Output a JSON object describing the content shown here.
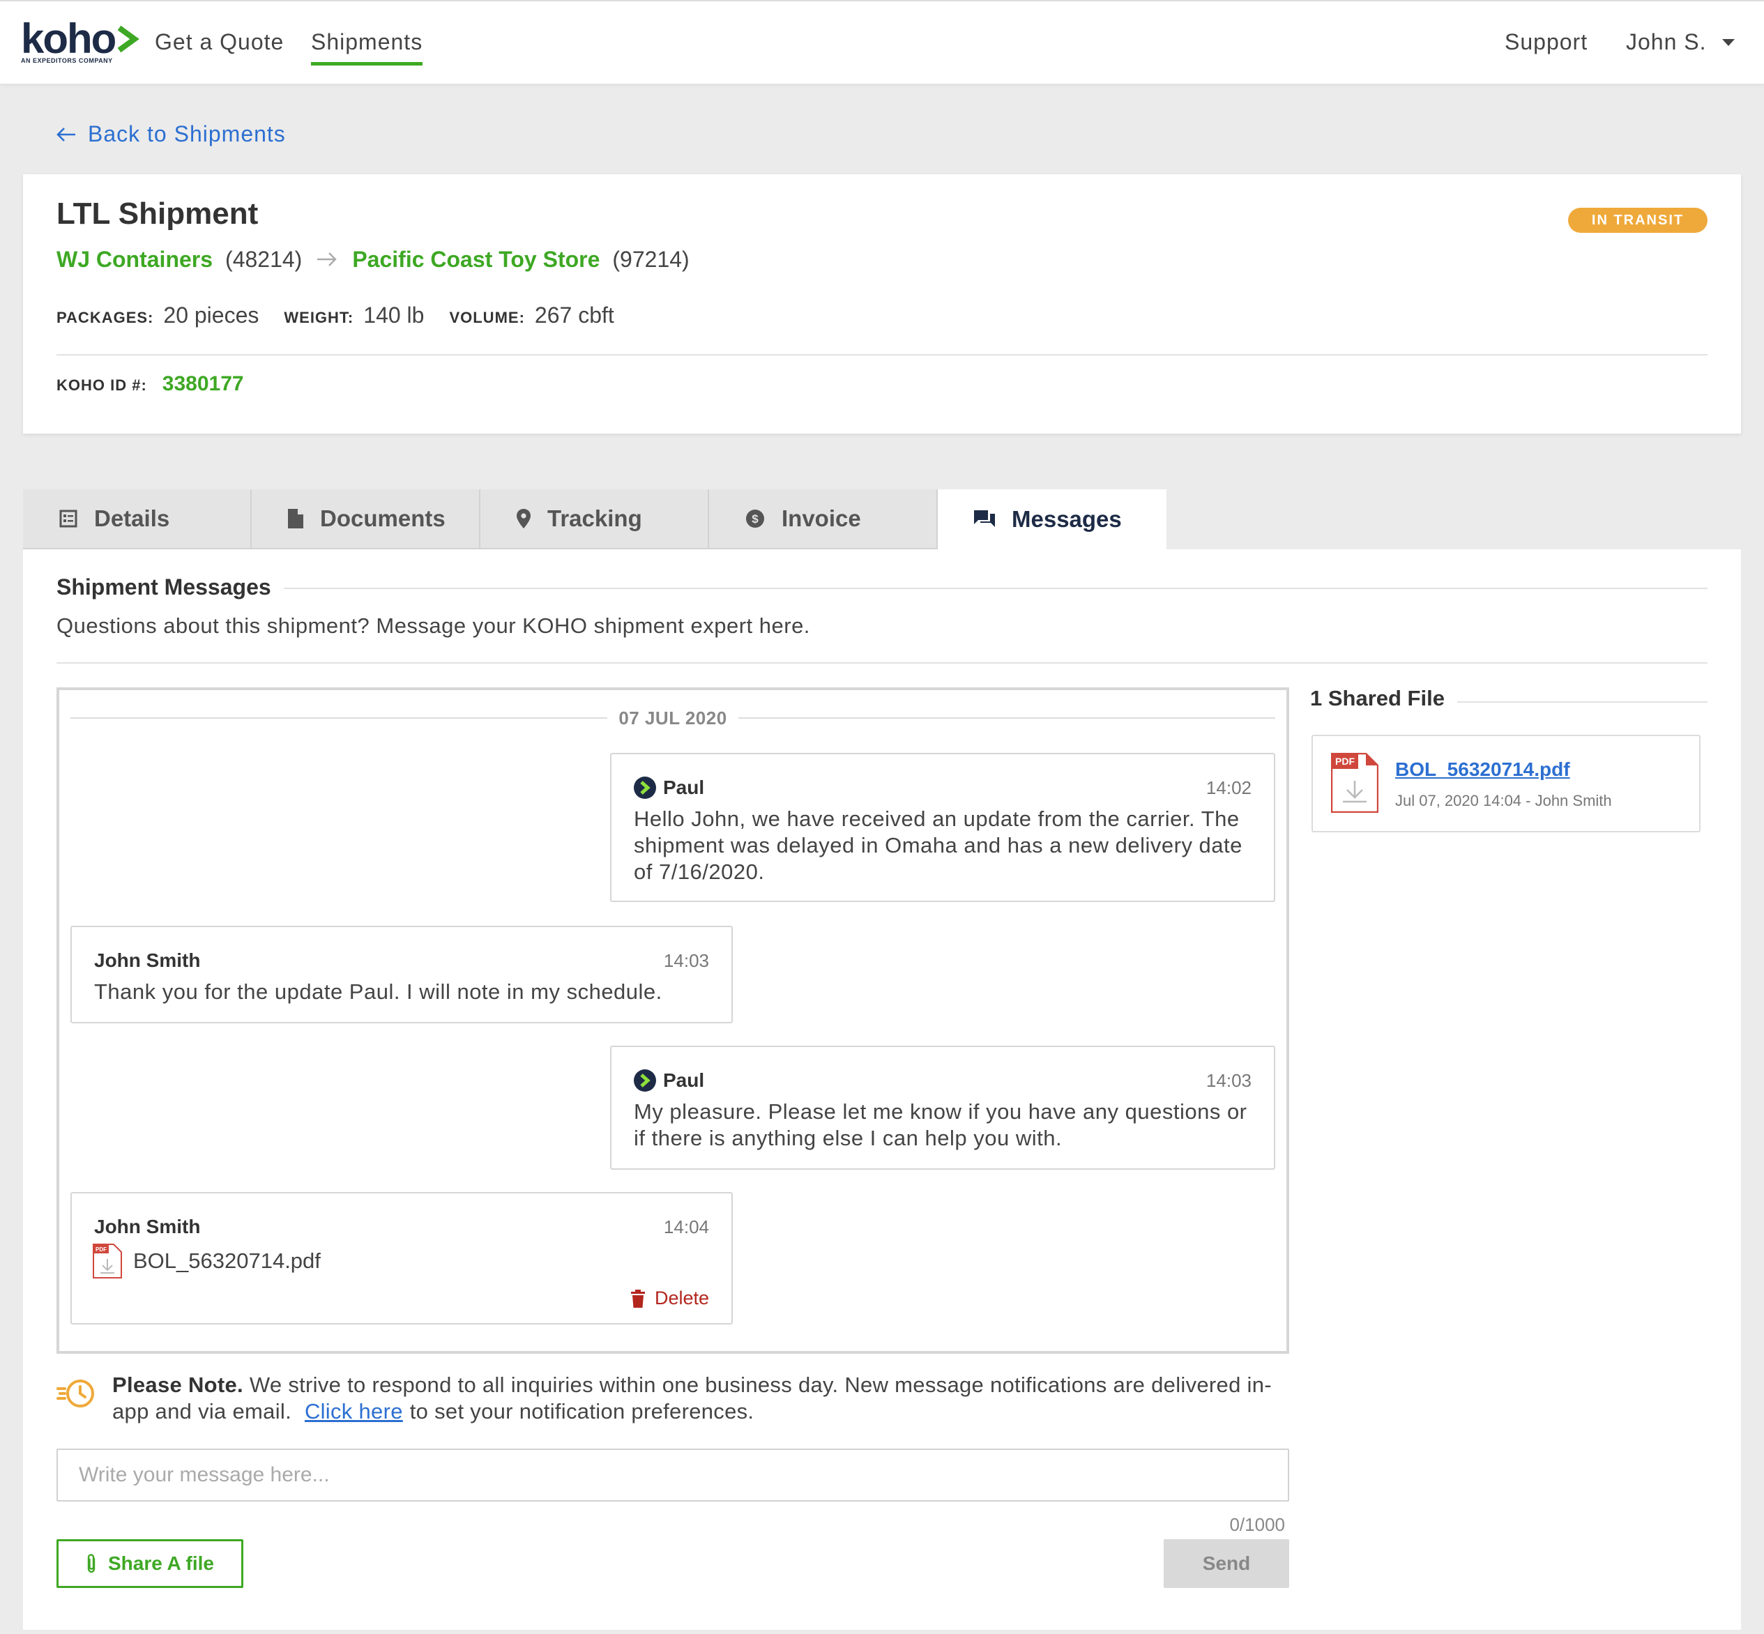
{
  "nav": {
    "logo_text": "koho",
    "logo_tagline": "AN EXPEDITORS COMPANY",
    "links": [
      "Get a Quote",
      "Shipments"
    ],
    "active_link": "Shipments",
    "support": "Support",
    "user": "John S."
  },
  "back_link": "Back to Shipments",
  "shipment": {
    "title": "LTL Shipment",
    "status": "IN TRANSIT",
    "origin": {
      "name": "WJ Containers",
      "zip": "(48214)"
    },
    "destination": {
      "name": "Pacific Coast Toy Store",
      "zip": "(97214)"
    },
    "packages_label": "PACKAGES:",
    "packages_value": "20 pieces",
    "weight_label": "WEIGHT:",
    "weight_value": "140 lb",
    "volume_label": "VOLUME:",
    "volume_value": "267 cbft",
    "koho_id_label": "KOHO ID #:",
    "koho_id_value": "3380177"
  },
  "tabs": [
    {
      "label": "Details",
      "icon": "details-icon"
    },
    {
      "label": "Documents",
      "icon": "document-icon"
    },
    {
      "label": "Tracking",
      "icon": "location-pin-icon"
    },
    {
      "label": "Invoice",
      "icon": "dollar-circle-icon"
    },
    {
      "label": "Messages",
      "icon": "chat-icon",
      "active": true
    }
  ],
  "messages_section": {
    "title": "Shipment Messages",
    "subtitle": "Questions about this shipment? Message your KOHO shipment expert here.",
    "date": "07 JUL 2020",
    "messages": [
      {
        "sender": "Paul",
        "time": "14:02",
        "text": "Hello John, we have received an update from the carrier. The shipment was delayed in Omaha and has a new delivery date of 7/16/2020."
      },
      {
        "sender": "John Smith",
        "time": "14:03",
        "text": "Thank you for the update Paul. I will note in my schedule."
      },
      {
        "sender": "Paul",
        "time": "14:03",
        "text": "My pleasure. Please let me know if you have any questions or if there is anything else I can help you with."
      },
      {
        "sender": "John Smith",
        "time": "14:04",
        "file": "BOL_56320714.pdf",
        "delete_label": "Delete"
      }
    ]
  },
  "shared_files": {
    "title": "1 Shared File",
    "files": [
      {
        "name": "BOL_56320714.pdf",
        "meta": "Jul 07, 2020 14:04 - John Smith",
        "icon_label": "PDF"
      }
    ]
  },
  "note": {
    "bold": "Please Note.",
    "text": "We strive to respond to all inquiries within one business day. New message notifications are delivered in-app and via email.",
    "link": "Click here",
    "after": "to set your notification preferences."
  },
  "composer": {
    "placeholder": "Write your message here...",
    "counter": "0/1000",
    "share_label": "Share A file",
    "send_label": "Send"
  },
  "colors": {
    "brand_green": "#3ea824",
    "navy": "#1d2b46",
    "link_blue": "#2c6fd1",
    "status_orange": "#efa93a",
    "delete_red": "#b3261e"
  }
}
